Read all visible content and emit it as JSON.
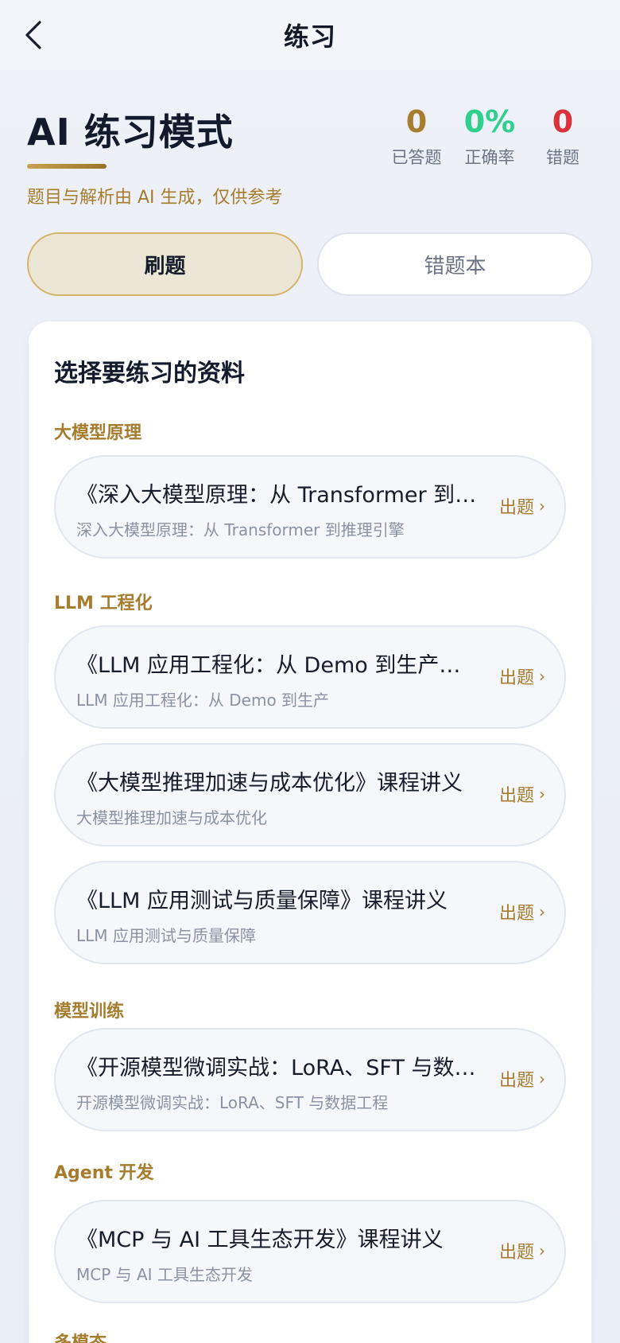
{
  "nav": {
    "title": "练习",
    "back_icon": "chevron-left-icon"
  },
  "header": {
    "title": "AI 练习模式",
    "subtitle": "题目与解析由 AI 生成，仅供参考",
    "stats": [
      {
        "value": "0",
        "label": "已答题",
        "color": "#a67c2e"
      },
      {
        "value": "0%",
        "label": "正确率",
        "color": "#2fcf8f"
      },
      {
        "value": "0",
        "label": "错题",
        "color": "#d9323a"
      }
    ]
  },
  "tabs": [
    {
      "label": "刷题",
      "active": true
    },
    {
      "label": "错题本",
      "active": false
    }
  ],
  "card": {
    "title": "选择要练习的资料",
    "action_label": "出题",
    "action_icon": "chevron-right-icon",
    "sections": [
      {
        "label": "大模型原理",
        "items": [
          {
            "title": "《深入大模型原理：从 Transformer 到推理引擎》课程讲义",
            "subtitle": "深入大模型原理：从 Transformer 到推理引擎"
          }
        ]
      },
      {
        "label": "LLM 工程化",
        "items": [
          {
            "title": "《LLM 应用工程化：从 Demo 到生产》课程讲义",
            "subtitle": "LLM 应用工程化：从 Demo 到生产"
          },
          {
            "title": "《大模型推理加速与成本优化》课程讲义",
            "subtitle": "大模型推理加速与成本优化"
          },
          {
            "title": "《LLM 应用测试与质量保障》课程讲义",
            "subtitle": "LLM 应用测试与质量保障"
          }
        ]
      },
      {
        "label": "模型训练",
        "items": [
          {
            "title": "《开源模型微调实战：LoRA、SFT 与数据工程》课程讲义",
            "subtitle": "开源模型微调实战：LoRA、SFT 与数据工程"
          }
        ]
      },
      {
        "label": "Agent 开发",
        "items": [
          {
            "title": "《MCP 与 AI 工具生态开发》课程讲义",
            "subtitle": "MCP 与 AI 工具生态开发"
          }
        ]
      },
      {
        "label": "多模态",
        "items": []
      }
    ]
  },
  "colors": {
    "accent_gold": "#a67c2e",
    "success_green": "#2fcf8f",
    "error_red": "#d9323a"
  }
}
